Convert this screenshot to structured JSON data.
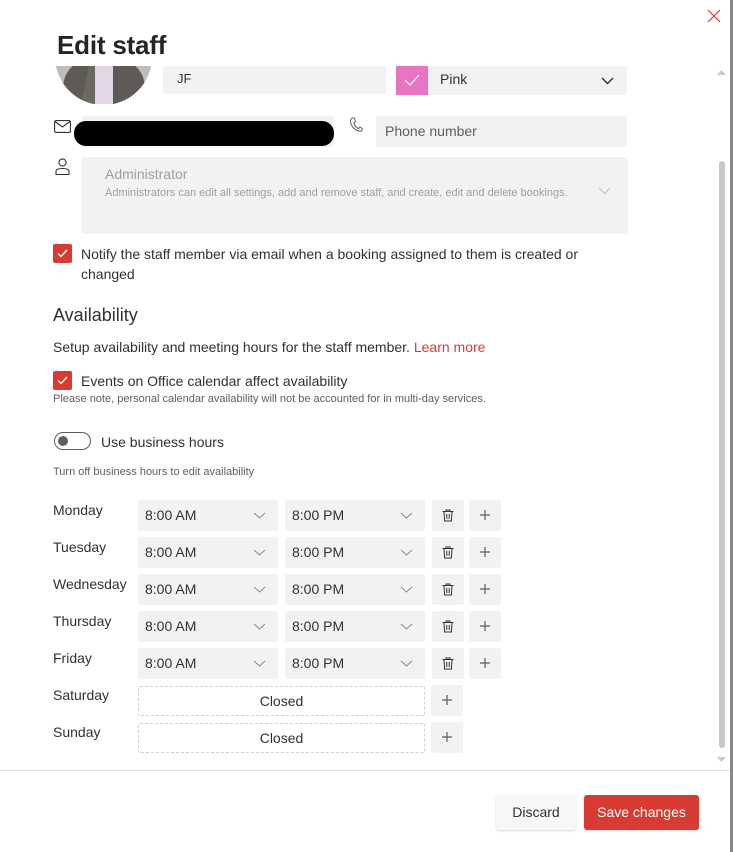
{
  "dialog": {
    "title": "Edit staff",
    "close_icon": "close-icon"
  },
  "profile": {
    "name_value": "JF",
    "color": {
      "label": "Pink",
      "swatch_hex": "#e873c1"
    },
    "email_value": "[redacted]",
    "phone_placeholder": "Phone number",
    "role": {
      "title": "Administrator",
      "description": "Administrators can edit all settings, add and remove staff, and create, edit and delete bookings."
    }
  },
  "notify": {
    "checked": true,
    "label": "Notify the staff member via email when a booking assigned to them is created or changed"
  },
  "availability": {
    "title": "Availability",
    "description": "Setup availability and meeting hours for the staff member.",
    "learn_more": "Learn more",
    "office_calendar": {
      "checked": true,
      "label": "Events on Office calendar affect availability",
      "note": "Please note, personal calendar availability will not be accounted for in multi-day services."
    },
    "business_hours": {
      "on": false,
      "label": "Use business hours",
      "hint": "Turn off business hours to edit availability"
    },
    "days": [
      {
        "day": "Monday",
        "start": "8:00 AM",
        "end": "8:00 PM",
        "closed": false
      },
      {
        "day": "Tuesday",
        "start": "8:00 AM",
        "end": "8:00 PM",
        "closed": false
      },
      {
        "day": "Wednesday",
        "start": "8:00 AM",
        "end": "8:00 PM",
        "closed": false
      },
      {
        "day": "Thursday",
        "start": "8:00 AM",
        "end": "8:00 PM",
        "closed": false
      },
      {
        "day": "Friday",
        "start": "8:00 AM",
        "end": "8:00 PM",
        "closed": false
      },
      {
        "day": "Saturday",
        "closed": true,
        "closed_label": "Closed"
      },
      {
        "day": "Sunday",
        "closed": true,
        "closed_label": "Closed"
      }
    ]
  },
  "footer": {
    "discard_label": "Discard",
    "save_label": "Save changes"
  },
  "colors": {
    "accent": "#d83b32",
    "field_bg": "#f3f2f1"
  }
}
